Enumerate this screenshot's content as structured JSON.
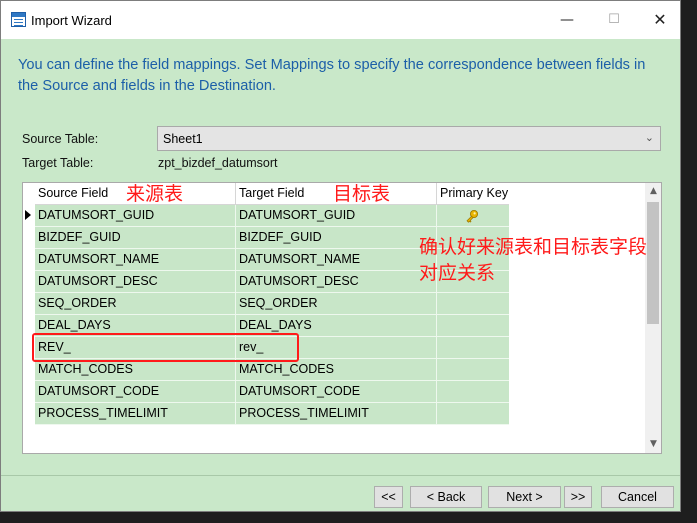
{
  "window": {
    "title": "Import Wizard",
    "controls": {
      "minimize": "—",
      "maximize": "☐",
      "close": "✕"
    }
  },
  "intro_text": "You can define the field mappings. Set Mappings to specify the correspondence between fields in the Source and fields in the Destination.",
  "source_table": {
    "label": "Source Table:",
    "value": "Sheet1"
  },
  "target_table": {
    "label": "Target Table:",
    "value": "zpt_bizdef_datumsort"
  },
  "grid": {
    "columns": [
      "Source Field",
      "Target Field",
      "Primary Key"
    ],
    "rows": [
      {
        "source": "DATUMSORT_GUID",
        "target": "DATUMSORT_GUID",
        "primary_key": true
      },
      {
        "source": "BIZDEF_GUID",
        "target": "BIZDEF_GUID",
        "primary_key": false
      },
      {
        "source": "DATUMSORT_NAME",
        "target": "DATUMSORT_NAME",
        "primary_key": false
      },
      {
        "source": "DATUMSORT_DESC",
        "target": "DATUMSORT_DESC",
        "primary_key": false
      },
      {
        "source": "SEQ_ORDER",
        "target": "SEQ_ORDER",
        "primary_key": false
      },
      {
        "source": "DEAL_DAYS",
        "target": "DEAL_DAYS",
        "primary_key": false
      },
      {
        "source": "REV_",
        "target": "rev_",
        "primary_key": false
      },
      {
        "source": "MATCH_CODES",
        "target": "MATCH_CODES",
        "primary_key": false
      },
      {
        "source": "DATUMSORT_CODE",
        "target": "DATUMSORT_CODE",
        "primary_key": false
      },
      {
        "source": "PROCESS_TIMELIMIT",
        "target": "PROCESS_TIMELIMIT",
        "primary_key": false
      }
    ]
  },
  "annotations": {
    "source": "来源表",
    "target": "目标表",
    "note_line1": "确认好来源表和目标表字段",
    "note_line2": "对应关系"
  },
  "buttons": {
    "first": "<<",
    "back": "< Back",
    "next": "Next >",
    "last": ">>",
    "cancel": "Cancel"
  },
  "colors": {
    "window_bg": "#c9e8c9",
    "intro_text": "#1c5fa8",
    "annotation": "#ff1a1a",
    "row_bg": "#c8e6c8"
  },
  "icons": {
    "primary_key": "key-icon",
    "app": "import-wizard-icon"
  }
}
